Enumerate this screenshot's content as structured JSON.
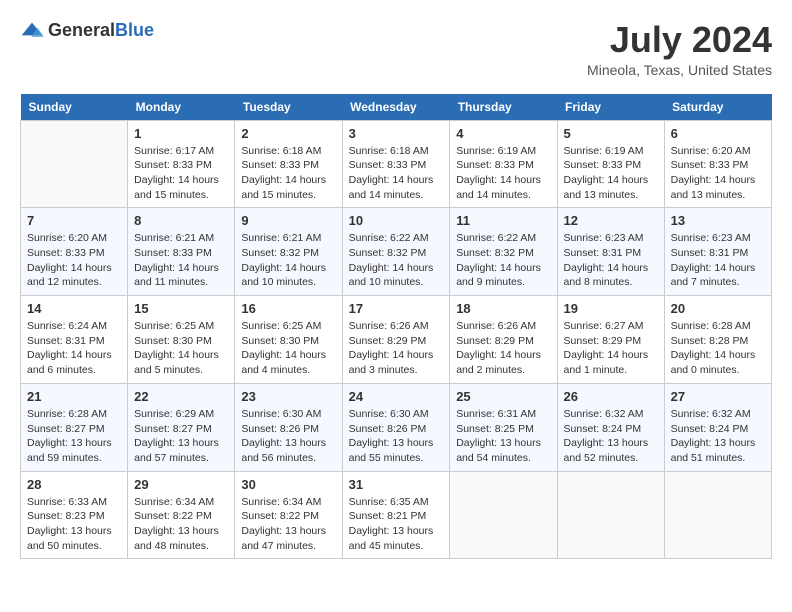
{
  "header": {
    "logo_general": "General",
    "logo_blue": "Blue",
    "title": "July 2024",
    "location": "Mineola, Texas, United States"
  },
  "calendar": {
    "days_of_week": [
      "Sunday",
      "Monday",
      "Tuesday",
      "Wednesday",
      "Thursday",
      "Friday",
      "Saturday"
    ],
    "weeks": [
      [
        {
          "day": "",
          "info": ""
        },
        {
          "day": "1",
          "info": "Sunrise: 6:17 AM\nSunset: 8:33 PM\nDaylight: 14 hours and 15 minutes."
        },
        {
          "day": "2",
          "info": "Sunrise: 6:18 AM\nSunset: 8:33 PM\nDaylight: 14 hours and 15 minutes."
        },
        {
          "day": "3",
          "info": "Sunrise: 6:18 AM\nSunset: 8:33 PM\nDaylight: 14 hours and 14 minutes."
        },
        {
          "day": "4",
          "info": "Sunrise: 6:19 AM\nSunset: 8:33 PM\nDaylight: 14 hours and 14 minutes."
        },
        {
          "day": "5",
          "info": "Sunrise: 6:19 AM\nSunset: 8:33 PM\nDaylight: 14 hours and 13 minutes."
        },
        {
          "day": "6",
          "info": "Sunrise: 6:20 AM\nSunset: 8:33 PM\nDaylight: 14 hours and 13 minutes."
        }
      ],
      [
        {
          "day": "7",
          "info": "Sunrise: 6:20 AM\nSunset: 8:33 PM\nDaylight: 14 hours and 12 minutes."
        },
        {
          "day": "8",
          "info": "Sunrise: 6:21 AM\nSunset: 8:33 PM\nDaylight: 14 hours and 11 minutes."
        },
        {
          "day": "9",
          "info": "Sunrise: 6:21 AM\nSunset: 8:32 PM\nDaylight: 14 hours and 10 minutes."
        },
        {
          "day": "10",
          "info": "Sunrise: 6:22 AM\nSunset: 8:32 PM\nDaylight: 14 hours and 10 minutes."
        },
        {
          "day": "11",
          "info": "Sunrise: 6:22 AM\nSunset: 8:32 PM\nDaylight: 14 hours and 9 minutes."
        },
        {
          "day": "12",
          "info": "Sunrise: 6:23 AM\nSunset: 8:31 PM\nDaylight: 14 hours and 8 minutes."
        },
        {
          "day": "13",
          "info": "Sunrise: 6:23 AM\nSunset: 8:31 PM\nDaylight: 14 hours and 7 minutes."
        }
      ],
      [
        {
          "day": "14",
          "info": "Sunrise: 6:24 AM\nSunset: 8:31 PM\nDaylight: 14 hours and 6 minutes."
        },
        {
          "day": "15",
          "info": "Sunrise: 6:25 AM\nSunset: 8:30 PM\nDaylight: 14 hours and 5 minutes."
        },
        {
          "day": "16",
          "info": "Sunrise: 6:25 AM\nSunset: 8:30 PM\nDaylight: 14 hours and 4 minutes."
        },
        {
          "day": "17",
          "info": "Sunrise: 6:26 AM\nSunset: 8:29 PM\nDaylight: 14 hours and 3 minutes."
        },
        {
          "day": "18",
          "info": "Sunrise: 6:26 AM\nSunset: 8:29 PM\nDaylight: 14 hours and 2 minutes."
        },
        {
          "day": "19",
          "info": "Sunrise: 6:27 AM\nSunset: 8:29 PM\nDaylight: 14 hours and 1 minute."
        },
        {
          "day": "20",
          "info": "Sunrise: 6:28 AM\nSunset: 8:28 PM\nDaylight: 14 hours and 0 minutes."
        }
      ],
      [
        {
          "day": "21",
          "info": "Sunrise: 6:28 AM\nSunset: 8:27 PM\nDaylight: 13 hours and 59 minutes."
        },
        {
          "day": "22",
          "info": "Sunrise: 6:29 AM\nSunset: 8:27 PM\nDaylight: 13 hours and 57 minutes."
        },
        {
          "day": "23",
          "info": "Sunrise: 6:30 AM\nSunset: 8:26 PM\nDaylight: 13 hours and 56 minutes."
        },
        {
          "day": "24",
          "info": "Sunrise: 6:30 AM\nSunset: 8:26 PM\nDaylight: 13 hours and 55 minutes."
        },
        {
          "day": "25",
          "info": "Sunrise: 6:31 AM\nSunset: 8:25 PM\nDaylight: 13 hours and 54 minutes."
        },
        {
          "day": "26",
          "info": "Sunrise: 6:32 AM\nSunset: 8:24 PM\nDaylight: 13 hours and 52 minutes."
        },
        {
          "day": "27",
          "info": "Sunrise: 6:32 AM\nSunset: 8:24 PM\nDaylight: 13 hours and 51 minutes."
        }
      ],
      [
        {
          "day": "28",
          "info": "Sunrise: 6:33 AM\nSunset: 8:23 PM\nDaylight: 13 hours and 50 minutes."
        },
        {
          "day": "29",
          "info": "Sunrise: 6:34 AM\nSunset: 8:22 PM\nDaylight: 13 hours and 48 minutes."
        },
        {
          "day": "30",
          "info": "Sunrise: 6:34 AM\nSunset: 8:22 PM\nDaylight: 13 hours and 47 minutes."
        },
        {
          "day": "31",
          "info": "Sunrise: 6:35 AM\nSunset: 8:21 PM\nDaylight: 13 hours and 45 minutes."
        },
        {
          "day": "",
          "info": ""
        },
        {
          "day": "",
          "info": ""
        },
        {
          "day": "",
          "info": ""
        }
      ]
    ]
  }
}
